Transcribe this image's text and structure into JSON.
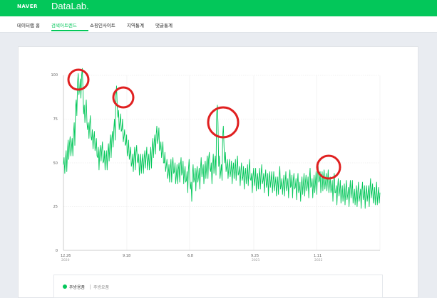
{
  "header": {
    "naver": "NAVER",
    "datalab": "DataLab."
  },
  "nav": {
    "items": [
      "데이터랩 홈",
      "검색어트렌드",
      "쇼핑인사이트",
      "지역통계",
      "댓글통계"
    ]
  },
  "legend": {
    "series": "주방용품",
    "sub": "주방요품"
  },
  "colors": {
    "accent": "#03c75a",
    "annotation": "#e02020"
  },
  "chart_data": {
    "type": "line",
    "ylim": [
      0,
      100
    ],
    "yticks": [
      "100",
      "75",
      "50",
      "25",
      "0"
    ],
    "xticks": [
      {
        "label": "12.26",
        "sub": "2020"
      },
      {
        "label": "9.18",
        "sub": ""
      },
      {
        "label": "6.8",
        "sub": ""
      },
      {
        "label": "9.25",
        "sub": "2021"
      },
      {
        "label": "1.11",
        "sub": "2022"
      }
    ],
    "grid": true,
    "series": [
      {
        "name": "주방용품",
        "points": [
          [
            0,
            49
          ],
          [
            1,
            52
          ],
          [
            2,
            57
          ],
          [
            3,
            61
          ],
          [
            4,
            59
          ],
          [
            5,
            67
          ],
          [
            6,
            82
          ],
          [
            7,
            96
          ],
          [
            8,
            92
          ],
          [
            9,
            100
          ],
          [
            10,
            78
          ],
          [
            11,
            80
          ],
          [
            12,
            69
          ],
          [
            13,
            72
          ],
          [
            14,
            63
          ],
          [
            15,
            64
          ],
          [
            16,
            59
          ],
          [
            17,
            53
          ],
          [
            18,
            56
          ],
          [
            19,
            57
          ],
          [
            20,
            51
          ],
          [
            21,
            53
          ],
          [
            22,
            56
          ],
          [
            23,
            60
          ],
          [
            24,
            64
          ],
          [
            25,
            70
          ],
          [
            26,
            88
          ],
          [
            27,
            76
          ],
          [
            28,
            73
          ],
          [
            29,
            69
          ],
          [
            30,
            65
          ],
          [
            31,
            61
          ],
          [
            32,
            57
          ],
          [
            33,
            55
          ],
          [
            34,
            50
          ],
          [
            35,
            53
          ],
          [
            36,
            56
          ],
          [
            37,
            50
          ],
          [
            38,
            49
          ],
          [
            39,
            51
          ],
          [
            40,
            52
          ],
          [
            41,
            53
          ],
          [
            42,
            51
          ],
          [
            43,
            54
          ],
          [
            44,
            58
          ],
          [
            45,
            62
          ],
          [
            46,
            66
          ],
          [
            47,
            64
          ],
          [
            48,
            58
          ],
          [
            49,
            57
          ],
          [
            50,
            50
          ],
          [
            51,
            48
          ],
          [
            52,
            44
          ],
          [
            53,
            46
          ],
          [
            54,
            49
          ],
          [
            55,
            45
          ],
          [
            56,
            43
          ],
          [
            57,
            46
          ],
          [
            58,
            48
          ],
          [
            59,
            45
          ],
          [
            60,
            44
          ],
          [
            61,
            40
          ],
          [
            62,
            46
          ],
          [
            63,
            35
          ],
          [
            64,
            44
          ],
          [
            65,
            41
          ],
          [
            66,
            44
          ],
          [
            67,
            42
          ],
          [
            68,
            47
          ],
          [
            69,
            45
          ],
          [
            70,
            46
          ],
          [
            71,
            48
          ],
          [
            72,
            52
          ],
          [
            73,
            45
          ],
          [
            74,
            49
          ],
          [
            75,
            50
          ],
          [
            76,
            78
          ],
          [
            77,
            48
          ],
          [
            78,
            45
          ],
          [
            79,
            66
          ],
          [
            80,
            50
          ],
          [
            81,
            48
          ],
          [
            82,
            47
          ],
          [
            83,
            45
          ],
          [
            84,
            46
          ],
          [
            85,
            47
          ],
          [
            86,
            48
          ],
          [
            87,
            44
          ],
          [
            88,
            45
          ],
          [
            89,
            42
          ],
          [
            90,
            43
          ],
          [
            91,
            44
          ],
          [
            92,
            46
          ],
          [
            93,
            40
          ],
          [
            94,
            42
          ],
          [
            95,
            41
          ],
          [
            96,
            40
          ],
          [
            97,
            42
          ],
          [
            98,
            43
          ],
          [
            99,
            40
          ],
          [
            100,
            41
          ],
          [
            101,
            38
          ],
          [
            102,
            41
          ],
          [
            103,
            40
          ],
          [
            104,
            39
          ],
          [
            105,
            38
          ],
          [
            106,
            37
          ],
          [
            107,
            42
          ],
          [
            108,
            37
          ],
          [
            109,
            38
          ],
          [
            110,
            39
          ],
          [
            111,
            37
          ],
          [
            112,
            41
          ],
          [
            113,
            37
          ],
          [
            114,
            40
          ],
          [
            115,
            36
          ],
          [
            116,
            38
          ],
          [
            117,
            35
          ],
          [
            118,
            37
          ],
          [
            119,
            38
          ],
          [
            120,
            39
          ],
          [
            121,
            37
          ],
          [
            122,
            41
          ],
          [
            123,
            37
          ],
          [
            124,
            38
          ],
          [
            125,
            39
          ],
          [
            126,
            44
          ],
          [
            127,
            40
          ],
          [
            128,
            39
          ],
          [
            129,
            42
          ],
          [
            130,
            39
          ],
          [
            131,
            40
          ],
          [
            132,
            38
          ],
          [
            133,
            35
          ],
          [
            134,
            38
          ],
          [
            135,
            33
          ],
          [
            136,
            36
          ],
          [
            137,
            34
          ],
          [
            138,
            33
          ],
          [
            139,
            33
          ],
          [
            140,
            34
          ],
          [
            141,
            32
          ],
          [
            142,
            35
          ],
          [
            143,
            34
          ],
          [
            144,
            31
          ],
          [
            145,
            32
          ],
          [
            146,
            33
          ],
          [
            147,
            31
          ],
          [
            148,
            34
          ],
          [
            149,
            31
          ],
          [
            150,
            33
          ],
          [
            151,
            32
          ],
          [
            152,
            35
          ],
          [
            153,
            34
          ],
          [
            154,
            31
          ],
          [
            155,
            33
          ],
          [
            156,
            32
          ],
          [
            157,
            33
          ]
        ]
      }
    ]
  }
}
